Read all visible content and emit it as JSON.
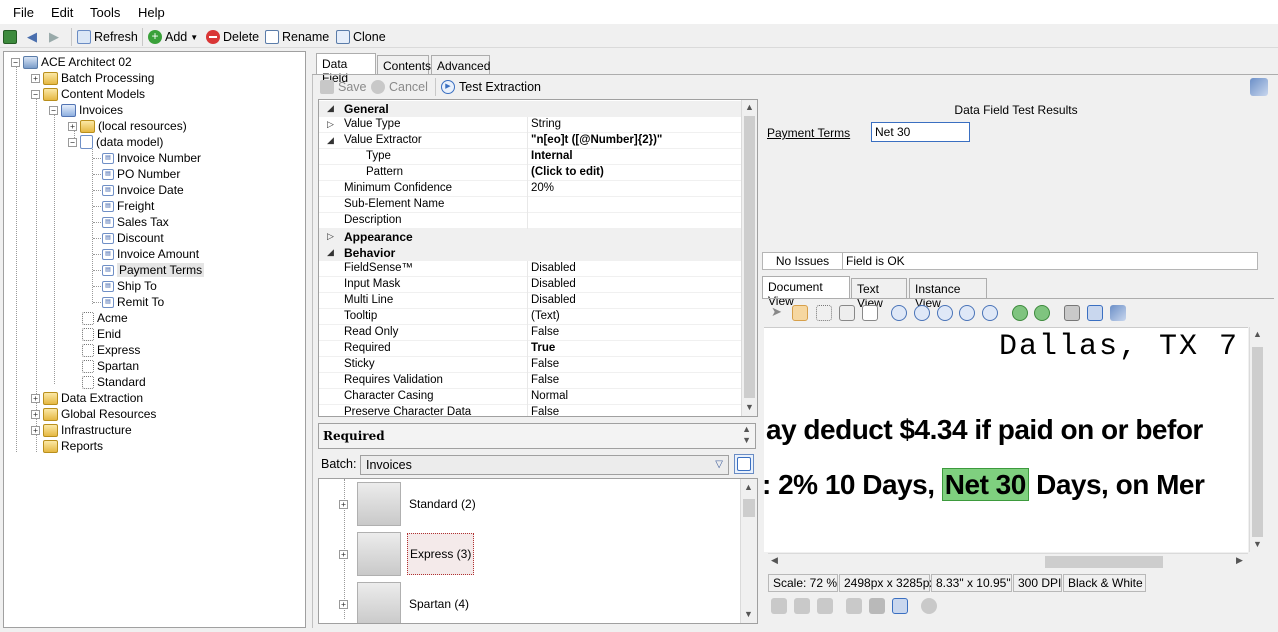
{
  "menu": [
    "File",
    "Edit",
    "Tools",
    "Help"
  ],
  "toolbar": {
    "refresh": "Refresh",
    "add": "Add",
    "delete": "Delete",
    "rename": "Rename",
    "clone": "Clone"
  },
  "tree": {
    "root": "ACE Architect 02",
    "batch_processing": "Batch Processing",
    "content_models": "Content Models",
    "invoices": "Invoices",
    "local_resources": "(local resources)",
    "data_model": "(data model)",
    "fields": [
      "Invoice Number",
      "PO Number",
      "Invoice Date",
      "Freight",
      "Sales Tax",
      "Discount",
      "Invoice Amount",
      "Payment Terms",
      "Ship To",
      "Remit To"
    ],
    "variants": [
      "Acme",
      "Enid",
      "Express",
      "Spartan",
      "Standard"
    ],
    "data_extraction": "Data Extraction",
    "global_resources": "Global Resources",
    "infrastructure": "Infrastructure",
    "reports": "Reports",
    "selected": "Payment Terms"
  },
  "tabs": [
    "Data Field",
    "Contents",
    "Advanced"
  ],
  "edit_bar": {
    "save": "Save",
    "cancel": "Cancel",
    "test": "Test Extraction"
  },
  "properties": [
    {
      "type": "cat",
      "name": "General",
      "caret": "◢"
    },
    {
      "type": "row",
      "name": "Value Type",
      "value": "String",
      "caret": "▷"
    },
    {
      "type": "row",
      "name": "Value Extractor",
      "value": "\"n[eo]t ([@Number]{2})\"",
      "caret": "◢",
      "bold": true
    },
    {
      "type": "row",
      "name": "Type",
      "value": "Internal",
      "indent": true,
      "bold": true
    },
    {
      "type": "row",
      "name": "Pattern",
      "value": "(Click to edit)",
      "indent": true,
      "bold": true
    },
    {
      "type": "row",
      "name": "Minimum Confidence",
      "value": "20%"
    },
    {
      "type": "row",
      "name": "Sub-Element Name",
      "value": ""
    },
    {
      "type": "row",
      "name": "Description",
      "value": ""
    },
    {
      "type": "cat",
      "name": "Appearance",
      "caret": "▷"
    },
    {
      "type": "cat",
      "name": "Behavior",
      "caret": "◢"
    },
    {
      "type": "row",
      "name": "FieldSense™",
      "value": "Disabled"
    },
    {
      "type": "row",
      "name": "Input Mask",
      "value": "Disabled"
    },
    {
      "type": "row",
      "name": "Multi Line",
      "value": "Disabled"
    },
    {
      "type": "row",
      "name": "Tooltip",
      "value": "(Text)"
    },
    {
      "type": "row",
      "name": "Read Only",
      "value": "False"
    },
    {
      "type": "row",
      "name": "Required",
      "value": "True",
      "bold": true
    },
    {
      "type": "row",
      "name": "Sticky",
      "value": "False"
    },
    {
      "type": "row",
      "name": "Requires Validation",
      "value": "False"
    },
    {
      "type": "row",
      "name": "Character Casing",
      "value": "Normal"
    },
    {
      "type": "row",
      "name": "Preserve Character Data",
      "value": "False"
    }
  ],
  "description_title": "Required",
  "batch": {
    "label": "Batch:",
    "value": "Invoices"
  },
  "batch_nodes": [
    "Standard (2)",
    "Express (3)",
    "Spartan (4)"
  ],
  "results": {
    "title": "Data Field Test Results",
    "field_label": "Payment Terms",
    "field_value": "Net 30",
    "issues": "No Issues",
    "status": "Field is OK"
  },
  "view_tabs": [
    "Document View",
    "Text View",
    "Instance View"
  ],
  "document": {
    "line1": "Dallas, TX 7",
    "line2": "ay deduct $4.34 if paid on or befor",
    "line3_pre": ": 2% 10 Days, ",
    "line3_hl": "Net 30",
    "line3_post": " Days, on Mer"
  },
  "image_info": {
    "scale": "Scale: 72 %",
    "size": "2498px x 3285px",
    "inches": "8.33\" x 10.95\"",
    "dpi": "300 DPI",
    "mode": "Black & White"
  },
  "colors": {
    "highlight": "#7fd07f",
    "selection": "#cfe2f7"
  }
}
